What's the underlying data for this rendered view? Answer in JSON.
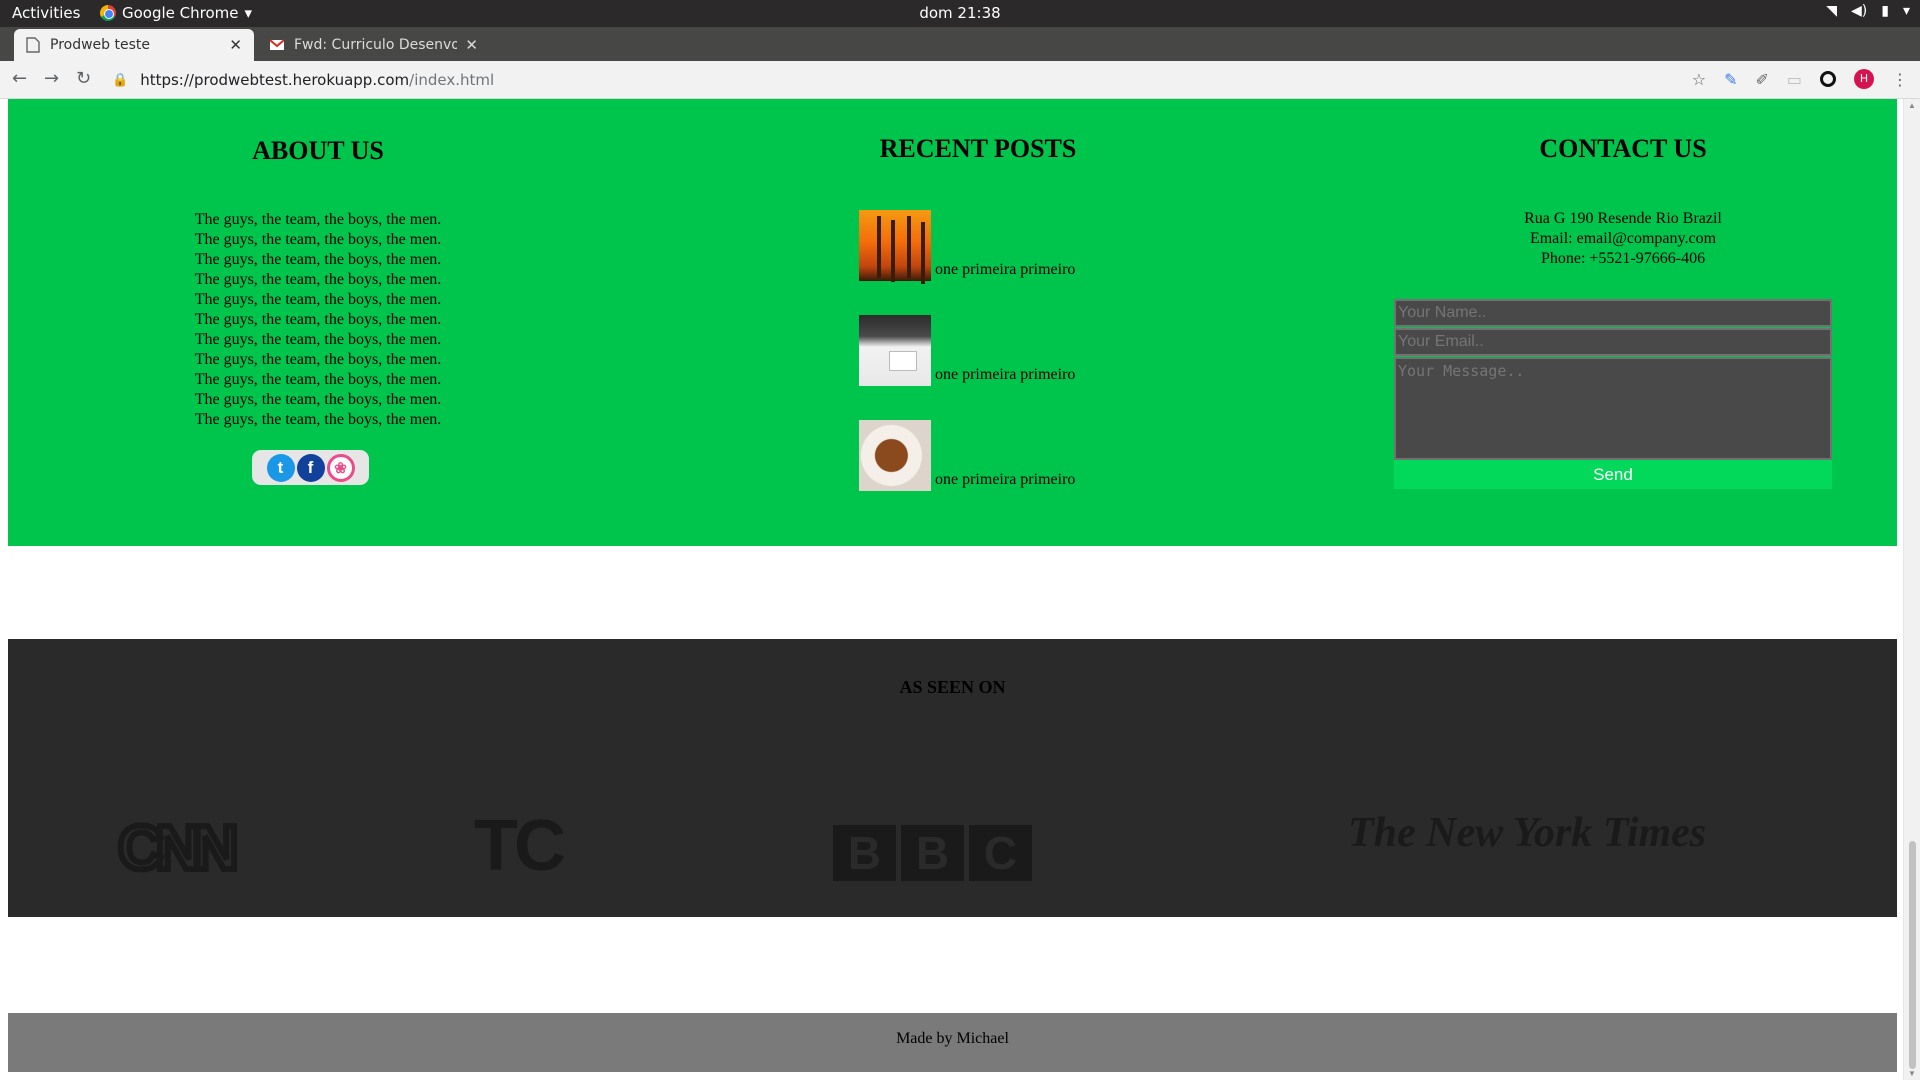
{
  "os": {
    "activities": "Activities",
    "app_menu": "Google Chrome",
    "clock": "dom 21:38"
  },
  "browser": {
    "tabs": [
      {
        "title": "Prodweb teste",
        "active": true
      },
      {
        "title": "Fwd: Curriculo Desenvolv",
        "active": false
      }
    ],
    "url_host": "https://prodwebtest.herokuapp.com",
    "url_path": "/index.html",
    "avatar_letter": "H"
  },
  "about": {
    "title": "ABOUT US",
    "lines": [
      "The guys, the team, the boys, the men.",
      "The guys, the team, the boys, the men.",
      "The guys, the team, the boys, the men.",
      "The guys, the team, the boys, the men.",
      "The guys, the team, the boys, the men.",
      "The guys, the team, the boys, the men.",
      "The guys, the team, the boys, the men.",
      "The guys, the team, the boys, the men.",
      "The guys, the team, the boys, the men.",
      "The guys, the team, the boys, the men.",
      "The guys, the team, the boys, the men."
    ],
    "social": [
      {
        "icon": "twitter-icon",
        "glyph": "t"
      },
      {
        "icon": "facebook-icon",
        "glyph": "f"
      },
      {
        "icon": "dribbble-icon",
        "glyph": "❀"
      }
    ]
  },
  "recent_posts": {
    "title": "RECENT POSTS",
    "posts": [
      {
        "label": "one primeira primeiro",
        "image": "palm-trees-sunset"
      },
      {
        "label": "one primeira primeiro",
        "image": "desk-laptop"
      },
      {
        "label": "one primeira primeiro",
        "image": "cake-plate"
      }
    ]
  },
  "contact": {
    "title": "CONTACT US",
    "address": "Rua G 190 Resende Rio Brazil",
    "email": "Email: email@company.com",
    "phone": "Phone: +5521-97666-406",
    "name_placeholder": "Your Name..",
    "email_placeholder": "Your Email..",
    "message_placeholder": "Your Message..",
    "send_label": "Send"
  },
  "as_seen_on": {
    "title": "AS SEEN ON",
    "logos": [
      "CNN",
      "TC",
      "BBC",
      "The New York Times"
    ]
  },
  "footer": {
    "text": "Made by Michael"
  },
  "colors": {
    "green_section": "#00c54c",
    "send_button": "#02d95a",
    "dark_section": "#2a2a2a",
    "footer": "#7a7a7a"
  }
}
